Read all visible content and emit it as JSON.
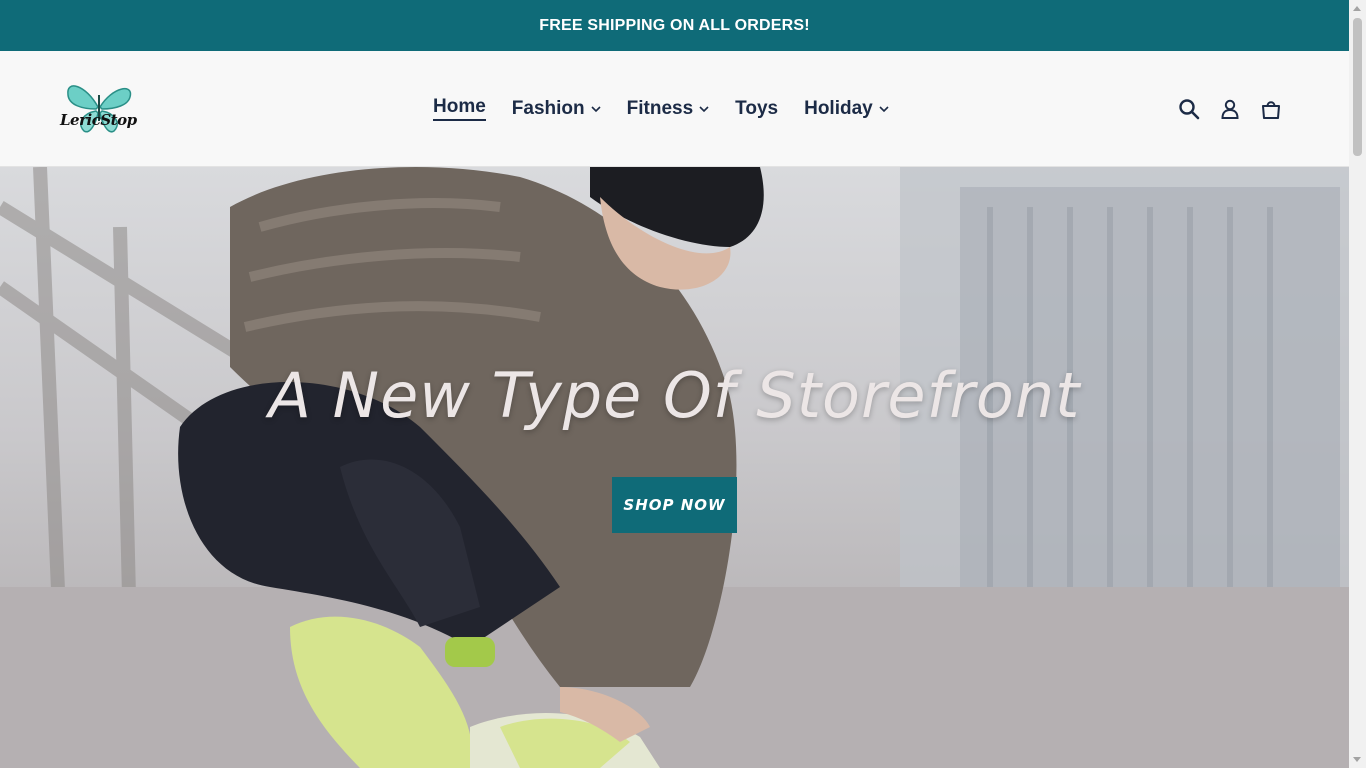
{
  "announcement": "FREE SHIPPING ON ALL ORDERS!",
  "brand": {
    "logo_text": "LericStop",
    "accent": "#0f6b78"
  },
  "nav": {
    "items": [
      {
        "label": "Home",
        "has_dropdown": false,
        "active": true
      },
      {
        "label": "Fashion",
        "has_dropdown": true
      },
      {
        "label": "Fitness",
        "has_dropdown": true
      },
      {
        "label": "Toys",
        "has_dropdown": false
      },
      {
        "label": "Holiday",
        "has_dropdown": true
      }
    ]
  },
  "header_icons": [
    "search-icon",
    "account-icon",
    "cart-icon"
  ],
  "hero": {
    "title": "A New Type Of Storefront",
    "button_label": "SHOP NOW"
  }
}
